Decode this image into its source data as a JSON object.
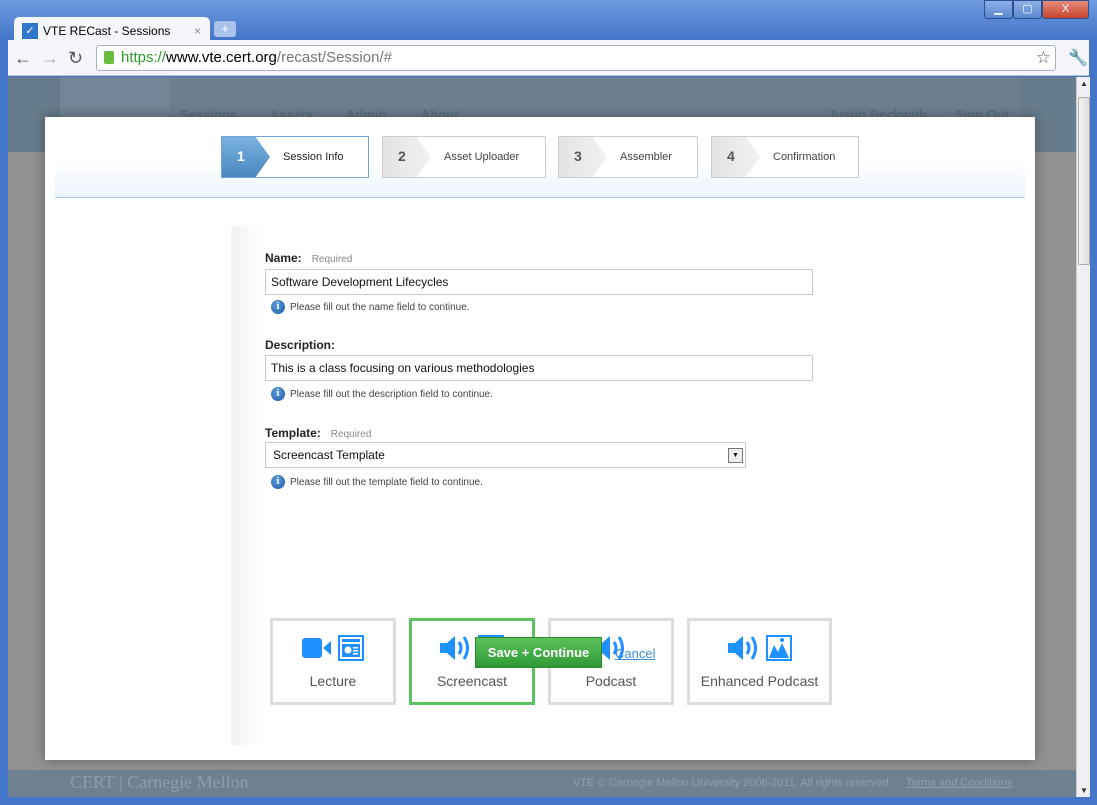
{
  "browser": {
    "tab_title": "VTE RECast - Sessions",
    "url_scheme": "https://",
    "url_host": "www.vte.cert.org",
    "url_path": "/recast/Session/#"
  },
  "header": {
    "nav": [
      "Sessions",
      "Assets",
      "Admin",
      "About"
    ],
    "user": "Justin Beckwith",
    "sign_out": "Sign Out"
  },
  "steps": [
    {
      "num": "1",
      "label": "Session Info",
      "active": true
    },
    {
      "num": "2",
      "label": "Asset Uploader"
    },
    {
      "num": "3",
      "label": "Assembler"
    },
    {
      "num": "4",
      "label": "Confirmation"
    }
  ],
  "form": {
    "name": {
      "label": "Name:",
      "required": "Required",
      "value": "Software Development Lifecycles",
      "hint": "Please fill out the name field to continue."
    },
    "description": {
      "label": "Description:",
      "value": "This is a class focusing on various methodologies",
      "hint": "Please fill out the description field to continue."
    },
    "template": {
      "label": "Template:",
      "required": "Required",
      "value": "Screencast Template",
      "hint": "Please fill out the template field to continue."
    }
  },
  "templates": [
    {
      "name": "Lecture",
      "icons": [
        "video-camera-icon",
        "slide-icon"
      ]
    },
    {
      "name": "Screencast",
      "icons": [
        "speaker-icon",
        "slide-icon"
      ],
      "selected": true
    },
    {
      "name": "Podcast",
      "icons": [
        "speaker-icon"
      ]
    },
    {
      "name": "Enhanced Podcast",
      "icons": [
        "speaker-icon",
        "image-icon"
      ]
    }
  ],
  "actions": {
    "save": "Save + Continue",
    "cancel": "Cancel"
  },
  "footer": {
    "logo": "CERT | Carnegie Mellon",
    "copyright": "VTE © Carnegie Mellon University 2006-2011. All rights reserved.",
    "terms": "Terms and Conditions"
  },
  "colors": {
    "accent": "#1e90ff",
    "selected_border": "#5cc15f",
    "save_button": "#3aa63f"
  }
}
